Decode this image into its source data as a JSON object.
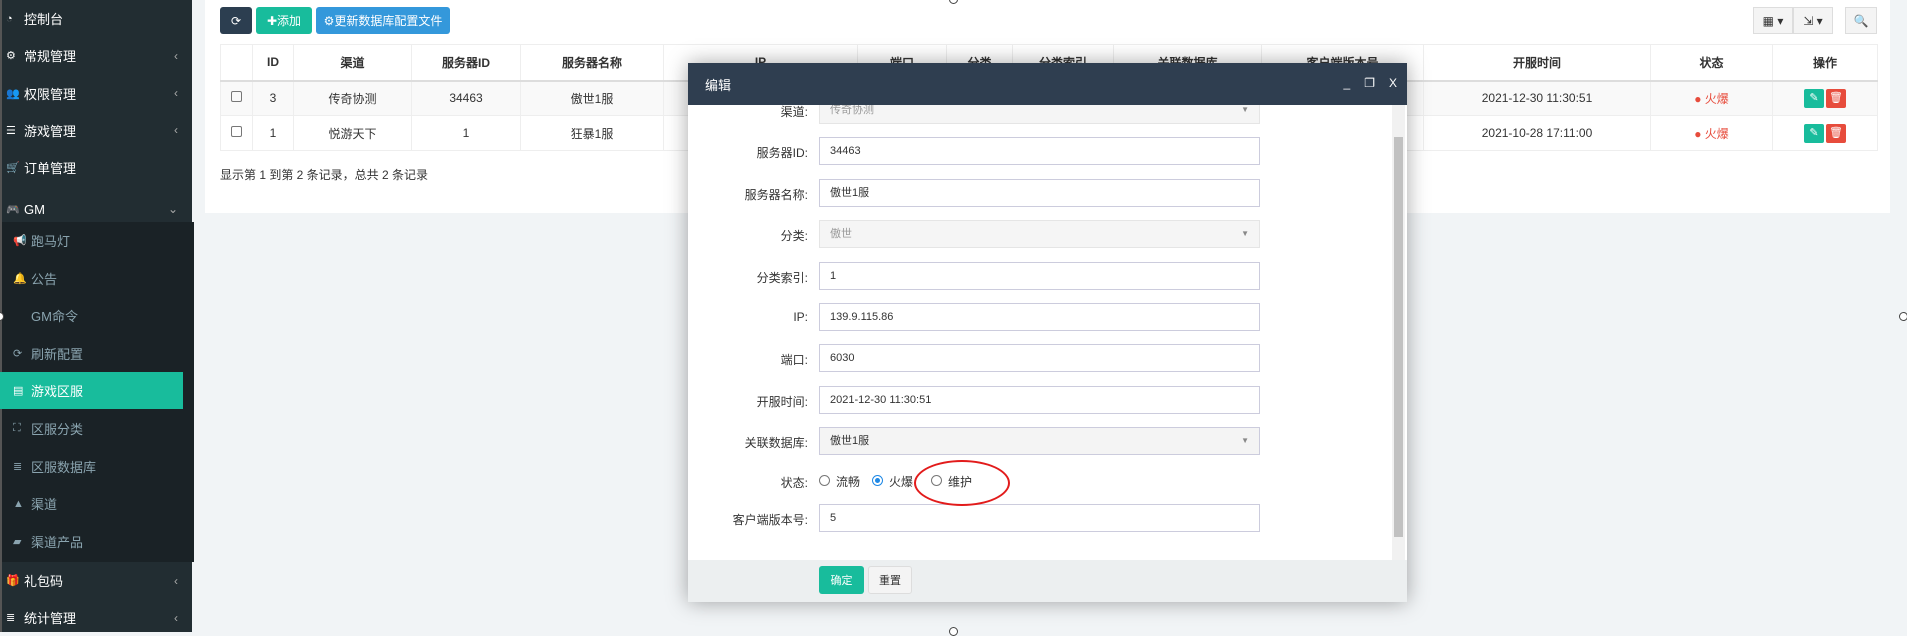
{
  "sidebar": {
    "items": [
      {
        "label": "控制台",
        "icon": "dashboard-icon",
        "chev": ""
      },
      {
        "label": "常规管理",
        "icon": "cogs-icon",
        "chev": "‹"
      },
      {
        "label": "权限管理",
        "icon": "users-icon",
        "chev": "‹"
      },
      {
        "label": "游戏管理",
        "icon": "list-icon",
        "chev": "‹"
      },
      {
        "label": "订单管理",
        "icon": "cart-icon",
        "chev": ""
      },
      {
        "label": "GM",
        "icon": "gamepad-icon",
        "chev": "⌄"
      }
    ],
    "subitems": [
      {
        "label": "跑马灯",
        "icon": "bullhorn-icon"
      },
      {
        "label": "公告",
        "icon": "bell-icon"
      },
      {
        "label": "GM命令",
        "icon": "code-icon"
      },
      {
        "label": "刷新配置",
        "icon": "refresh-icon"
      },
      {
        "label": "游戏区服",
        "icon": "server-icon",
        "active": true
      },
      {
        "label": "区服分类",
        "icon": "sitemap-icon"
      },
      {
        "label": "区服数据库",
        "icon": "database-icon"
      },
      {
        "label": "渠道",
        "icon": "road-icon"
      },
      {
        "label": "渠道产品",
        "icon": "shopping-bag-icon"
      }
    ],
    "bottom": [
      {
        "label": "礼包码",
        "icon": "gift-icon",
        "chev": "‹"
      },
      {
        "label": "统计管理",
        "icon": "database-icon",
        "chev": "‹"
      }
    ]
  },
  "toolbar": {
    "add": "添加",
    "update": "更新数据库配置文件"
  },
  "table": {
    "headers": [
      "",
      "ID",
      "渠道",
      "服务器ID",
      "服务器名称",
      "IP",
      "端口",
      "分类",
      "分类索引",
      "关联数据库",
      "客户端版本号",
      "开服时间",
      "状态",
      "操作"
    ],
    "rows": [
      {
        "id": "3",
        "channel": "传奇协测",
        "server_id": "34463",
        "server_name": "傲世1服",
        "open_time": "2021-12-30 11:30:51",
        "status": "火爆"
      },
      {
        "id": "1",
        "channel": "悦游天下",
        "server_id": "1",
        "server_name": "狂暴1服",
        "open_time": "2021-10-28 17:11:00",
        "status": "火爆"
      }
    ],
    "footer": "显示第 1 到第 2 条记录，总共 2 条记录"
  },
  "modal": {
    "title": "编辑",
    "fields": [
      {
        "label": "渠道:",
        "value": "传奇协测",
        "type": "select",
        "disabled": true
      },
      {
        "label": "服务器ID:",
        "value": "34463"
      },
      {
        "label": "服务器名称:",
        "value": "傲世1服"
      },
      {
        "label": "分类:",
        "value": "傲世",
        "type": "select",
        "disabled": true
      },
      {
        "label": "分类索引:",
        "value": "1"
      },
      {
        "label": "IP:",
        "value": "139.9.115.86"
      },
      {
        "label": "端口:",
        "value": "6030"
      },
      {
        "label": "开服时间:",
        "value": "2021-12-30 11:30:51"
      },
      {
        "label": "关联数据库:",
        "value": "傲世1服",
        "type": "select"
      }
    ],
    "status_label": "状态:",
    "status_options": [
      "流畅",
      "火爆",
      "维护"
    ],
    "status_selected": "火爆",
    "version_label": "客户端版本号:",
    "version_value": "5",
    "ok": "确定",
    "reset": "重置"
  },
  "colors": {
    "accent": "#18bc9c",
    "danger": "#e74c3c",
    "primary": "#3498db",
    "dark": "#2c3e50"
  }
}
